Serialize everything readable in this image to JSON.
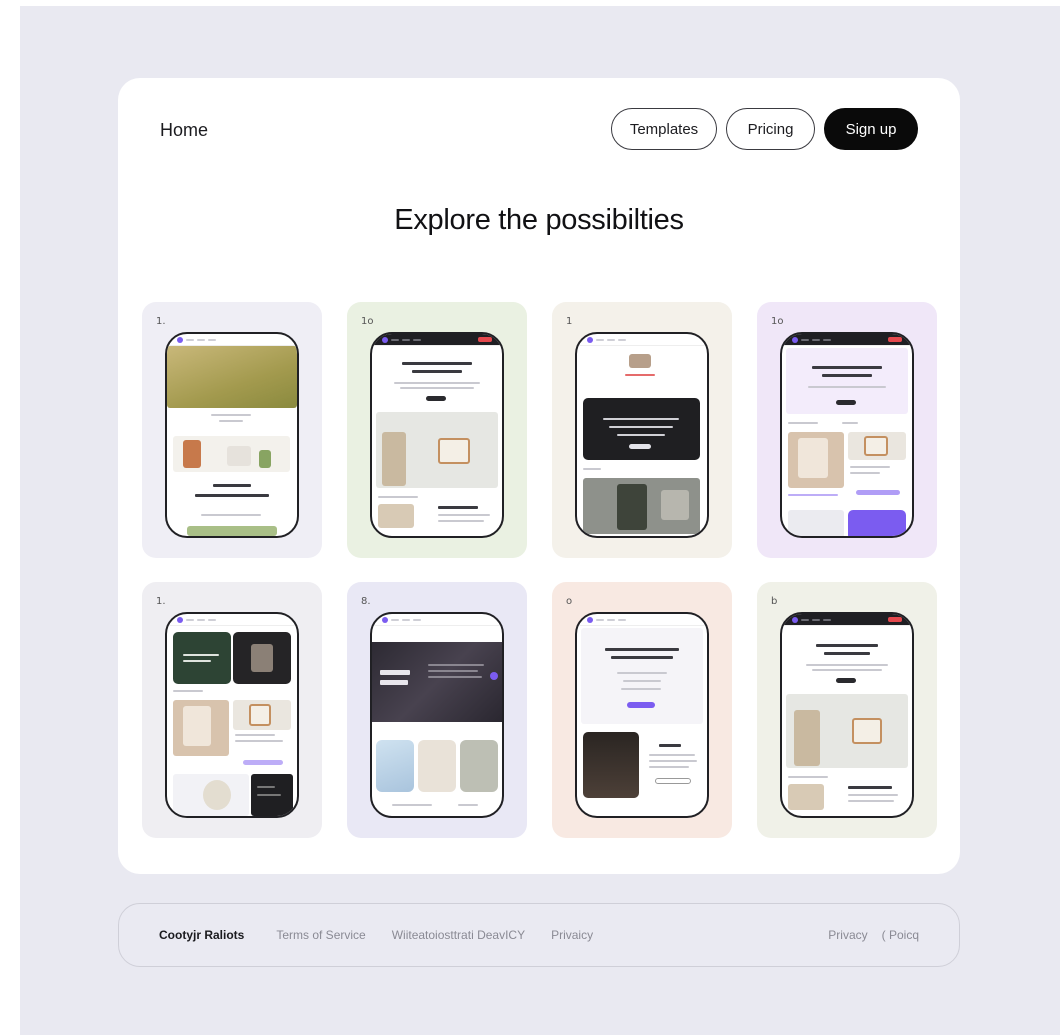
{
  "header": {
    "home_label": "Home",
    "templates_label": "Templates",
    "pricing_label": "Pricing",
    "signup_label": "Sign up"
  },
  "main": {
    "headline": "Explore the possibilties"
  },
  "tiles": [
    {
      "num": "1.",
      "bg": "#efeef5"
    },
    {
      "num": "1o",
      "bg": "#eaf1e2"
    },
    {
      "num": "1",
      "bg": "#f4f1ea"
    },
    {
      "num": "1o",
      "bg": "#f0e7f8"
    },
    {
      "num": "1.",
      "bg": "#efeef2"
    },
    {
      "num": "8.",
      "bg": "#e9e8f5"
    },
    {
      "num": "o",
      "bg": "#f8e9e2"
    },
    {
      "num": "b",
      "bg": "#f0f1e8"
    }
  ],
  "footer": {
    "brand": "Cootyjr Raliots",
    "link1": "Terms of Service",
    "link2": "Wiiteatoiosttrati DeavICY",
    "link3": "Privaicy",
    "right1": "Privacy",
    "right2": "( Poicq"
  },
  "colors": {
    "accent": "#7b5cf0",
    "stage_bg": "#e9e9f1",
    "card_bg": "#ffffff",
    "dark_button": "#0a0a0a"
  }
}
